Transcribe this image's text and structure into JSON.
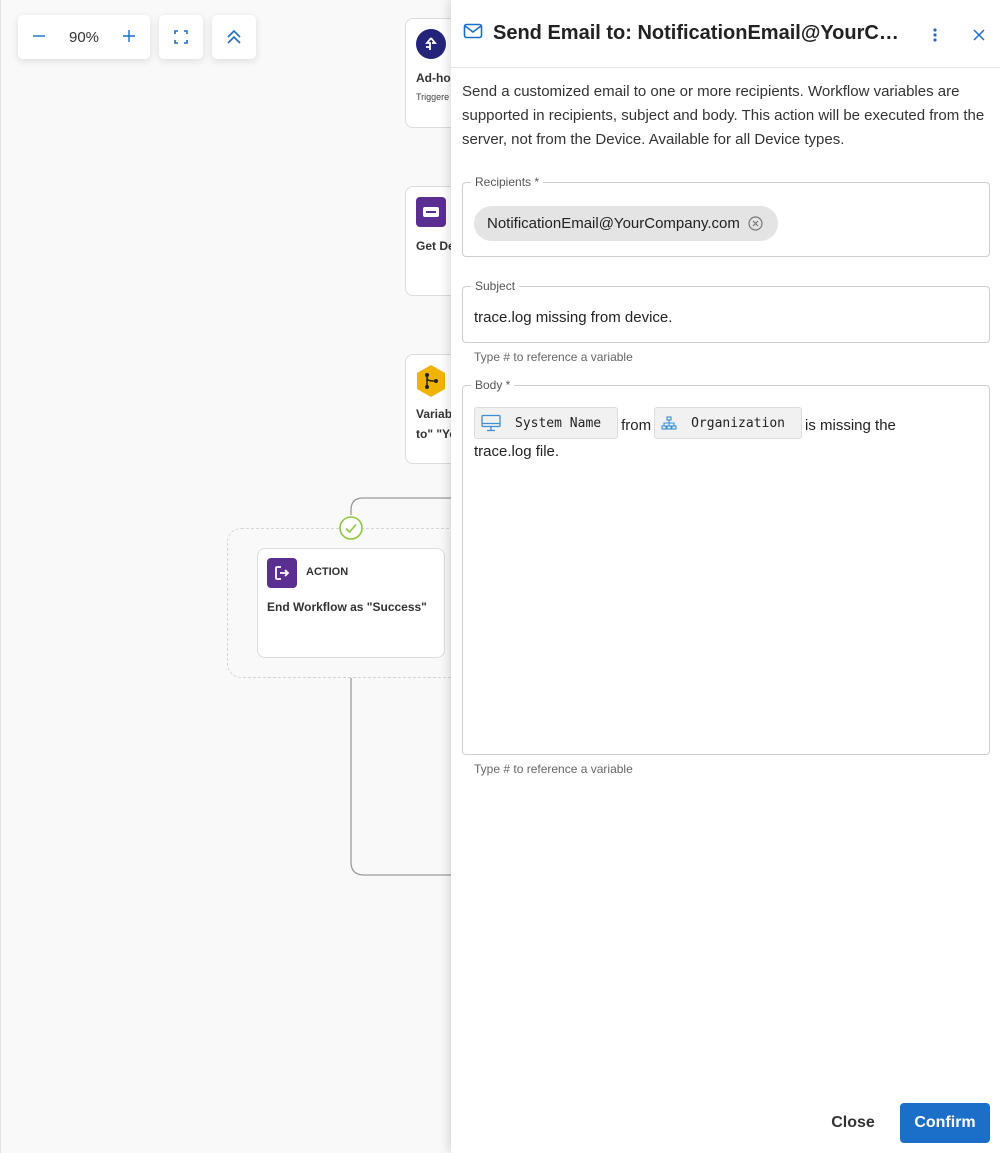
{
  "canvas": {
    "zoom": "90%",
    "zoom_out_icon": "minus-icon",
    "zoom_in_icon": "plus-icon",
    "fit_icon": "fit-screen-icon",
    "collapse_icon": "double-chevron-up-icon",
    "nodes": {
      "trigger": {
        "title": "Ad-hoc",
        "subtitle": "Triggere",
        "icon": "trigger-icon",
        "color": "#23237a"
      },
      "get_device": {
        "title": "Get De",
        "icon": "device-data-icon",
        "color": "#5b2e91"
      },
      "condition": {
        "title_line1": "Variab",
        "title_line2": "to\" \"Ye",
        "icon": "branch-icon",
        "color": "#f0b400"
      },
      "end_action": {
        "type_label": "ACTION",
        "title": "End Workflow as \"Success\"",
        "icon": "exit-icon",
        "color": "#5b2e91"
      }
    },
    "success_icon": "check-circle-icon",
    "success_color": "#8dc63f"
  },
  "panel": {
    "title": "Send Email to: NotificationEmail@YourCompany.com",
    "title_icon": "mail-icon",
    "more_icon": "more-vertical-icon",
    "close_icon": "close-icon",
    "description": "Send a customized email to one or more recipients. Workflow variables are supported in recipients, subject and body. This action will be executed from the server, not from the Device. Available for all Device types.",
    "recipients": {
      "label": "Recipients *",
      "chips": [
        "NotificationEmail@YourCompany.com"
      ],
      "chip_remove_icon": "remove-circle-icon"
    },
    "subject": {
      "label": "Subject",
      "value": "trace.log missing from device.",
      "hint": "Type # to reference a variable"
    },
    "body": {
      "label": "Body *",
      "var1": {
        "label": "System Name",
        "icon": "monitor-icon"
      },
      "text1": "from",
      "var2": {
        "label": "Organization",
        "icon": "org-tree-icon"
      },
      "text2": "is missing the",
      "text3": "trace.log file.",
      "hint": "Type # to reference a variable"
    },
    "footer": {
      "close_label": "Close",
      "confirm_label": "Confirm"
    },
    "accent_color": "#1b6fc8"
  }
}
